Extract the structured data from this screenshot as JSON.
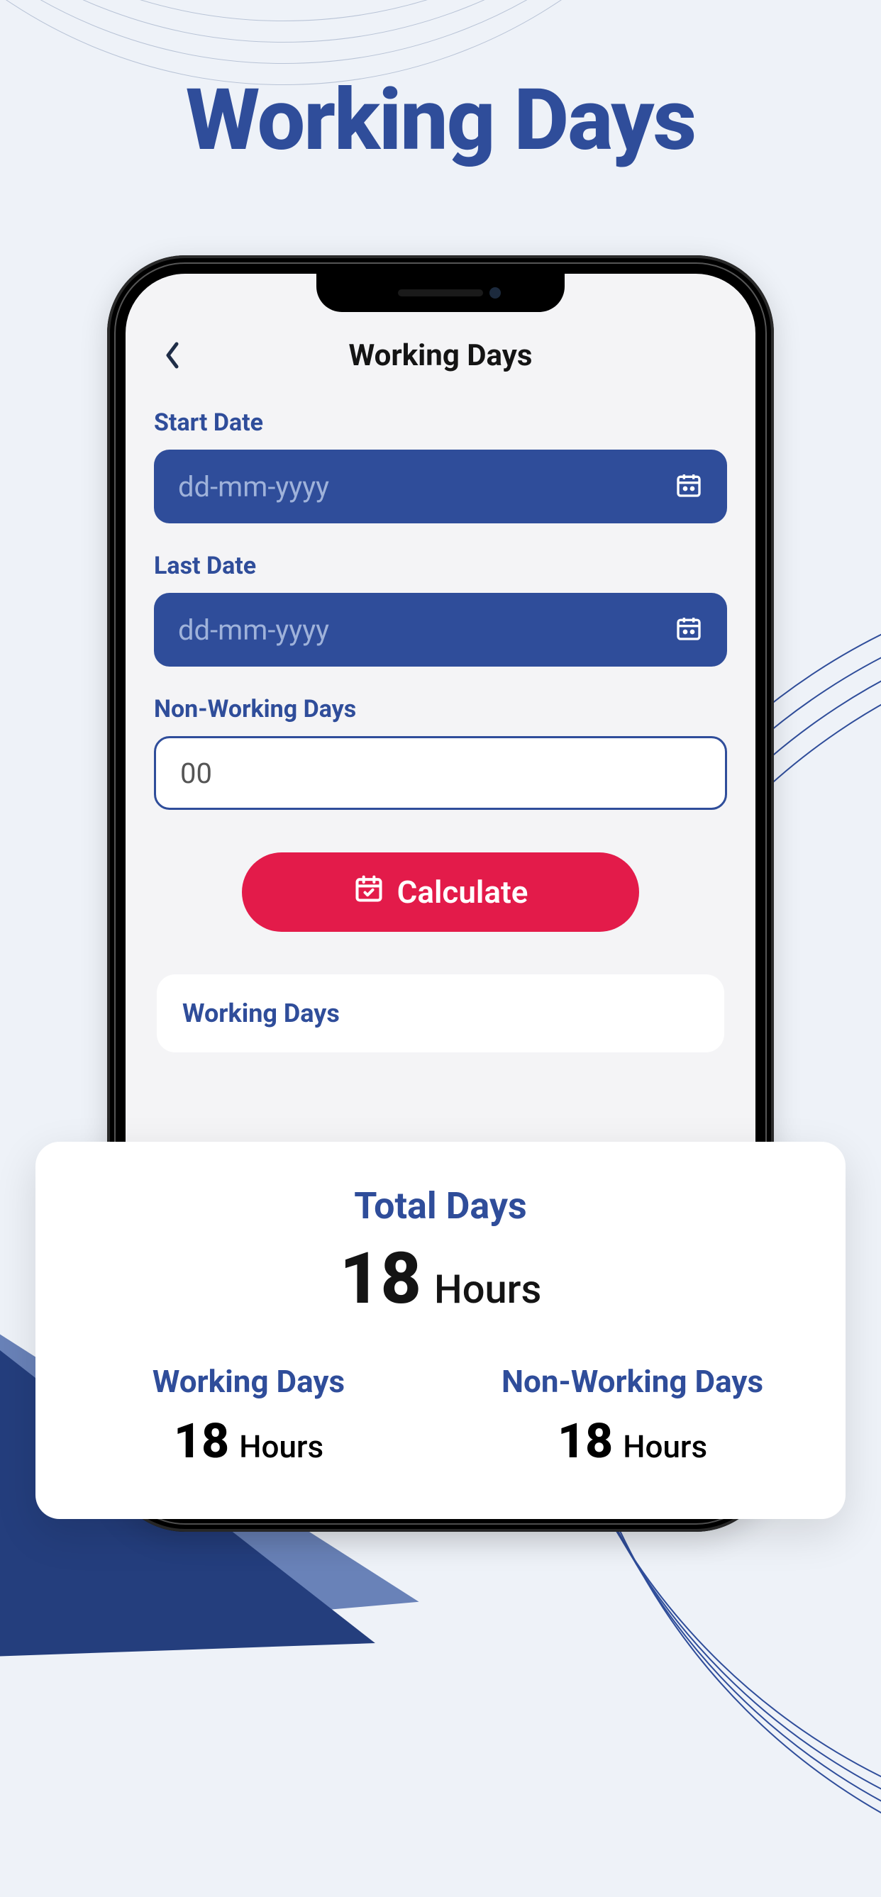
{
  "hero": {
    "title": "Working Days"
  },
  "app": {
    "header_title": "Working Days",
    "start_date_label": "Start Date",
    "start_date_placeholder": "dd-mm-yyyy",
    "last_date_label": "Last Date",
    "last_date_placeholder": "dd-mm-yyyy",
    "nonworking_label": "Non-Working Days",
    "nonworking_value": "00",
    "calculate_label": "Calculate",
    "result_section_title": "Working Days"
  },
  "results": {
    "total_label": "Total Days",
    "total_value": "18",
    "total_unit": "Hours",
    "working_label": "Working Days",
    "working_value": "18",
    "working_unit": "Hours",
    "nonworking_label": "Non-Working Days",
    "nonworking_value": "18",
    "nonworking_unit": "Hours"
  }
}
